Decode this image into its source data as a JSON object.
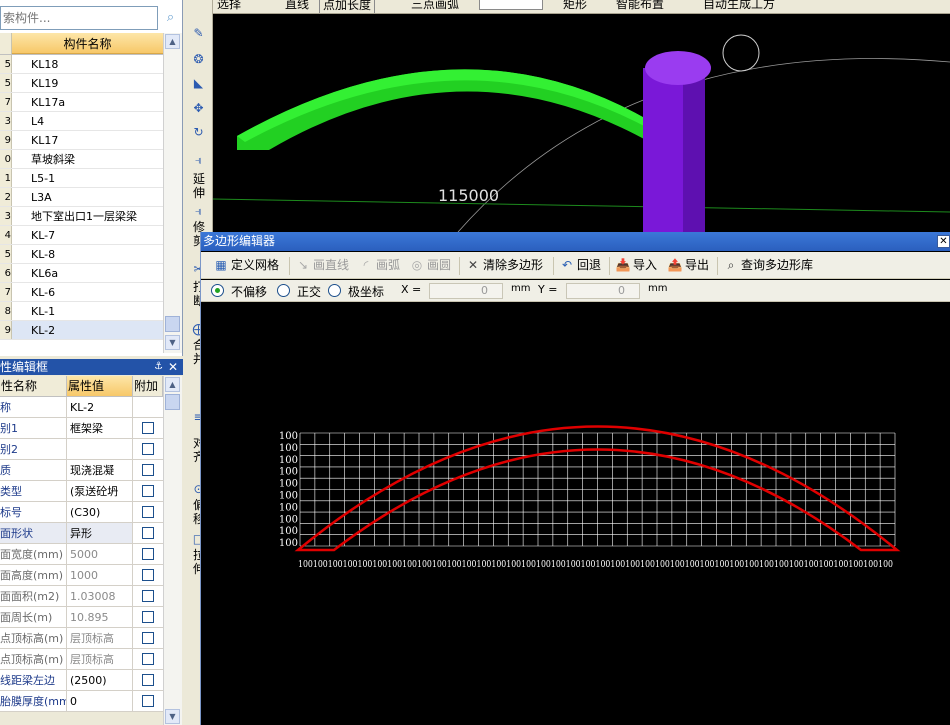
{
  "search": {
    "placeholder": "索构件..."
  },
  "component_list": {
    "header": "构件名称",
    "rows": [
      {
        "num": "5",
        "name": "KL18"
      },
      {
        "num": "5",
        "name": "KL19"
      },
      {
        "num": "7",
        "name": "KL17a"
      },
      {
        "num": "3",
        "name": "L4"
      },
      {
        "num": "9",
        "name": "KL17"
      },
      {
        "num": "0",
        "name": "草坡斜梁"
      },
      {
        "num": "1",
        "name": "L5-1"
      },
      {
        "num": "2",
        "name": "L3A"
      },
      {
        "num": "3",
        "name": "地下室出口1一层梁梁"
      },
      {
        "num": "4",
        "name": "KL-7"
      },
      {
        "num": "5",
        "name": "KL-8"
      },
      {
        "num": "6",
        "name": "KL6a"
      },
      {
        "num": "7",
        "name": "KL-6"
      },
      {
        "num": "8",
        "name": "KL-1"
      },
      {
        "num": "9",
        "name": "KL-2"
      }
    ],
    "selected_index": 14
  },
  "property_panel": {
    "title": "性编辑框",
    "pin_icon": "pin-icon",
    "headers": {
      "name": "性名称",
      "value": "属性值",
      "attach": "附加"
    },
    "rows": [
      {
        "key": "称",
        "value": "KL-2",
        "dim": false,
        "check": false
      },
      {
        "key": "别1",
        "value": "框架梁",
        "dim": false,
        "check": true
      },
      {
        "key": "别2",
        "value": "",
        "dim": false,
        "check": true
      },
      {
        "key": "质",
        "value": "现浇混凝",
        "dim": false,
        "check": true
      },
      {
        "key": "类型",
        "value": "(泵送砼坍",
        "dim": false,
        "check": true
      },
      {
        "key": "标号",
        "value": "(C30)",
        "dim": false,
        "check": true
      },
      {
        "key": "面形状",
        "value": "异形",
        "dim": false,
        "check": true,
        "shade": true
      },
      {
        "key": "面宽度(mm)",
        "value": "5000",
        "dim": true,
        "check": true
      },
      {
        "key": "面高度(mm)",
        "value": "1000",
        "dim": true,
        "check": true
      },
      {
        "key": "面面积(m2)",
        "value": "1.03008",
        "dim": true,
        "check": true
      },
      {
        "key": "面周长(m)",
        "value": "10.895",
        "dim": true,
        "check": true
      },
      {
        "key": "点顶标高(m)",
        "value": "层顶标高",
        "dim": true,
        "check": true
      },
      {
        "key": "点顶标高(m)",
        "value": "层顶标高",
        "dim": true,
        "check": true
      },
      {
        "key": "线距梁左边",
        "value": "(2500)",
        "dim": false,
        "check": true
      },
      {
        "key": "胎膜厚度(mm",
        "value": "0",
        "dim": false,
        "check": true
      }
    ]
  },
  "vertical_toolbar": {
    "labels": [
      "延",
      "伸",
      "修",
      "剪",
      "打",
      "断",
      "合",
      "并",
      "对",
      "齐",
      "偏",
      "移",
      "拉",
      "伸"
    ]
  },
  "top_toolbar": {
    "items": [
      "选择",
      "直线",
      "点加长度",
      "三点画弧",
      "矩形",
      "智能布置",
      "自动生成工方"
    ]
  },
  "view3d": {
    "dimension_label": "115000"
  },
  "editor": {
    "title": "多边形编辑器",
    "buttons": {
      "define_grid": "定义网格",
      "draw_line": "画直线",
      "draw_arc": "画弧",
      "draw_circle": "画圆",
      "clear_polygon": "清除多边形",
      "undo": "回退",
      "import": "导入",
      "export": "导出",
      "query_library": "查询多边形库"
    },
    "options": {
      "no_offset": "不偏移",
      "orthogonal": "正交",
      "polar": "极坐标",
      "x_label": "X =",
      "y_label": "Y =",
      "x_value": "0",
      "y_value": "0",
      "unit": "mm",
      "selected": "no_offset"
    },
    "grid": {
      "y_tick_label": "100",
      "x_tick_label": "100",
      "y_tick_count": 10,
      "x_tick_count": 40,
      "columns": 40,
      "rows": 10
    },
    "colors": {
      "background": "#000000",
      "grid": "#ffffff",
      "polygon": "#e00000",
      "tick_text": "#ffffff"
    }
  }
}
